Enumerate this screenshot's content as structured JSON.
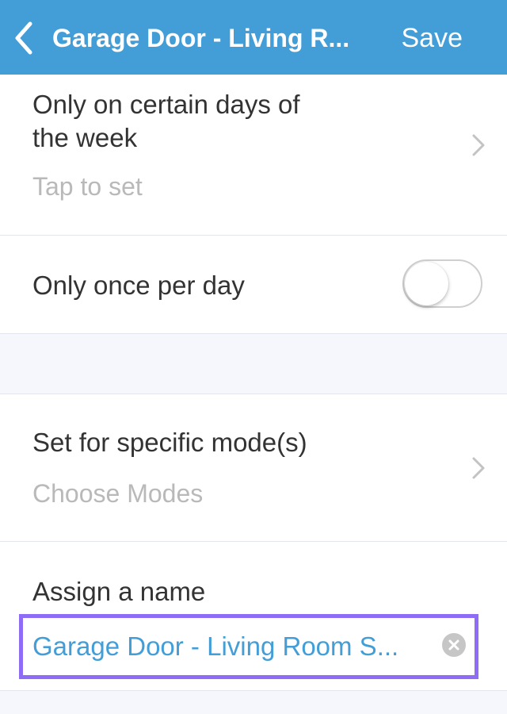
{
  "navbar": {
    "back_icon": "chevron-left-icon",
    "title": "Garage Door - Living R...",
    "save_label": "Save",
    "background_color": "#439ed7"
  },
  "days_row": {
    "title_line1": "Only on certain days of",
    "title_line2": "the week",
    "subtitle": "Tap to set",
    "chevron_icon": "chevron-right-icon"
  },
  "once_row": {
    "title": "Only once per day",
    "toggle_on": false
  },
  "modes_row": {
    "title": "Set for specific mode(s)",
    "subtitle": "Choose Modes",
    "chevron_icon": "chevron-right-icon"
  },
  "name_row": {
    "label": "Assign a name",
    "value": "Garage Door - Living Room S...",
    "clear_icon": "clear-icon",
    "highlight_color": "#8e6cf5"
  }
}
